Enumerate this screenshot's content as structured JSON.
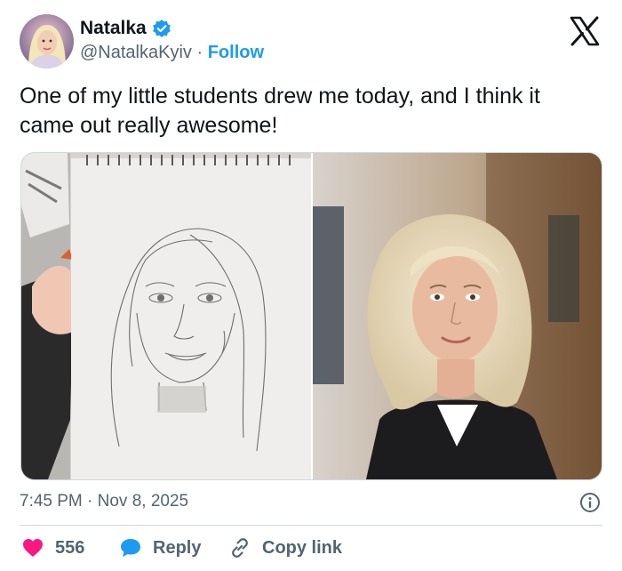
{
  "author": {
    "display_name": "Natalka",
    "handle": "@NatalkaKyiv",
    "separator": "·",
    "follow_label": "Follow",
    "verified": true
  },
  "tweet": {
    "text": "One of my little students drew me today, and I think it came out really awesome!",
    "timestamp": "7:45 PM · Nov 8, 2025"
  },
  "actions": {
    "like_count": "556",
    "reply_label": "Reply",
    "copy_label": "Copy link"
  },
  "icons": {
    "verified": "verified-badge-icon",
    "logo": "x-logo-icon",
    "info": "info-icon",
    "like": "heart-icon",
    "reply": "speech-bubble-icon",
    "copy": "link-icon"
  },
  "colors": {
    "accent": "#1d9bf0",
    "like": "#f91880",
    "text": "#0f1419",
    "secondary": "#536471",
    "border": "#cfd9de"
  }
}
